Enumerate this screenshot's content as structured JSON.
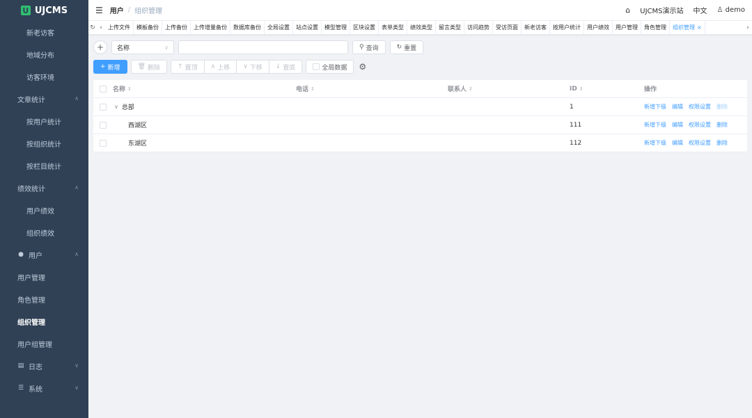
{
  "app": {
    "logo_text": "UJCMS",
    "logo_mark": "U"
  },
  "sidebar": {
    "items": [
      {
        "label": "新老访客",
        "type": "sub"
      },
      {
        "label": "地域分布",
        "type": "sub"
      },
      {
        "label": "访客环境",
        "type": "sub"
      },
      {
        "label": "文章统计",
        "type": "group"
      },
      {
        "label": "按用户统计",
        "type": "sub"
      },
      {
        "label": "按组织统计",
        "type": "sub"
      },
      {
        "label": "按栏目统计",
        "type": "sub"
      },
      {
        "label": "绩效统计",
        "type": "group"
      },
      {
        "label": "用户绩效",
        "type": "sub"
      },
      {
        "label": "组织绩效",
        "type": "sub"
      },
      {
        "label": "用户",
        "type": "icon-group",
        "icon": "user-icon"
      },
      {
        "label": "用户管理",
        "type": "item"
      },
      {
        "label": "角色管理",
        "type": "item"
      },
      {
        "label": "组织管理",
        "type": "item",
        "active": true
      },
      {
        "label": "用户组管理",
        "type": "item"
      },
      {
        "label": "日志",
        "type": "icon-group",
        "icon": "clipboard-icon"
      },
      {
        "label": "系统",
        "type": "icon-group",
        "icon": "sliders-icon"
      }
    ]
  },
  "header": {
    "breadcrumb_parent": "用户",
    "breadcrumb_sep": "/",
    "breadcrumb_current": "组织管理",
    "site_name": "UJCMS演示站",
    "language": "中文",
    "user": "demo"
  },
  "tags": [
    "上传文件",
    "模板备份",
    "上传备份",
    "上传增量备份",
    "数据库备份",
    "全局设置",
    "站点设置",
    "模型管理",
    "区块设置",
    "表单类型",
    "绩效类型",
    "留言类型",
    "访问趋势",
    "受访页面",
    "新老访客",
    "按用户统计",
    "用户绩效",
    "用户管理",
    "角色管理",
    "组织管理"
  ],
  "active_tag": "组织管理",
  "toolbar": {
    "field_select": "名称",
    "query_label": "查询",
    "reset_label": "重置",
    "add_label": "新增",
    "delete_label": "删除",
    "top_label": "置顶",
    "up_label": "上移",
    "down_label": "下移",
    "bottom_label": "置底",
    "global_data_label": "全局数据"
  },
  "table": {
    "columns": {
      "name": "名称",
      "phone": "电话",
      "contact": "联系人",
      "id": "ID",
      "ops": "操作"
    },
    "rows": [
      {
        "name": "总部",
        "phone": "",
        "contact": "",
        "id": "1",
        "level": 1,
        "expandable": true,
        "delete_disabled": true
      },
      {
        "name": "西湖区",
        "phone": "",
        "contact": "",
        "id": "111",
        "level": 2,
        "expandable": false,
        "delete_disabled": false
      },
      {
        "name": "东湖区",
        "phone": "",
        "contact": "",
        "id": "112",
        "level": 2,
        "expandable": false,
        "delete_disabled": false
      }
    ],
    "ops": {
      "add_child": "新增下级",
      "edit": "编辑",
      "permission": "权限设置",
      "delete": "删除"
    }
  },
  "colors": {
    "sidebar_bg": "#304156",
    "accent": "#409eff",
    "logo_green": "#2fbf71"
  }
}
